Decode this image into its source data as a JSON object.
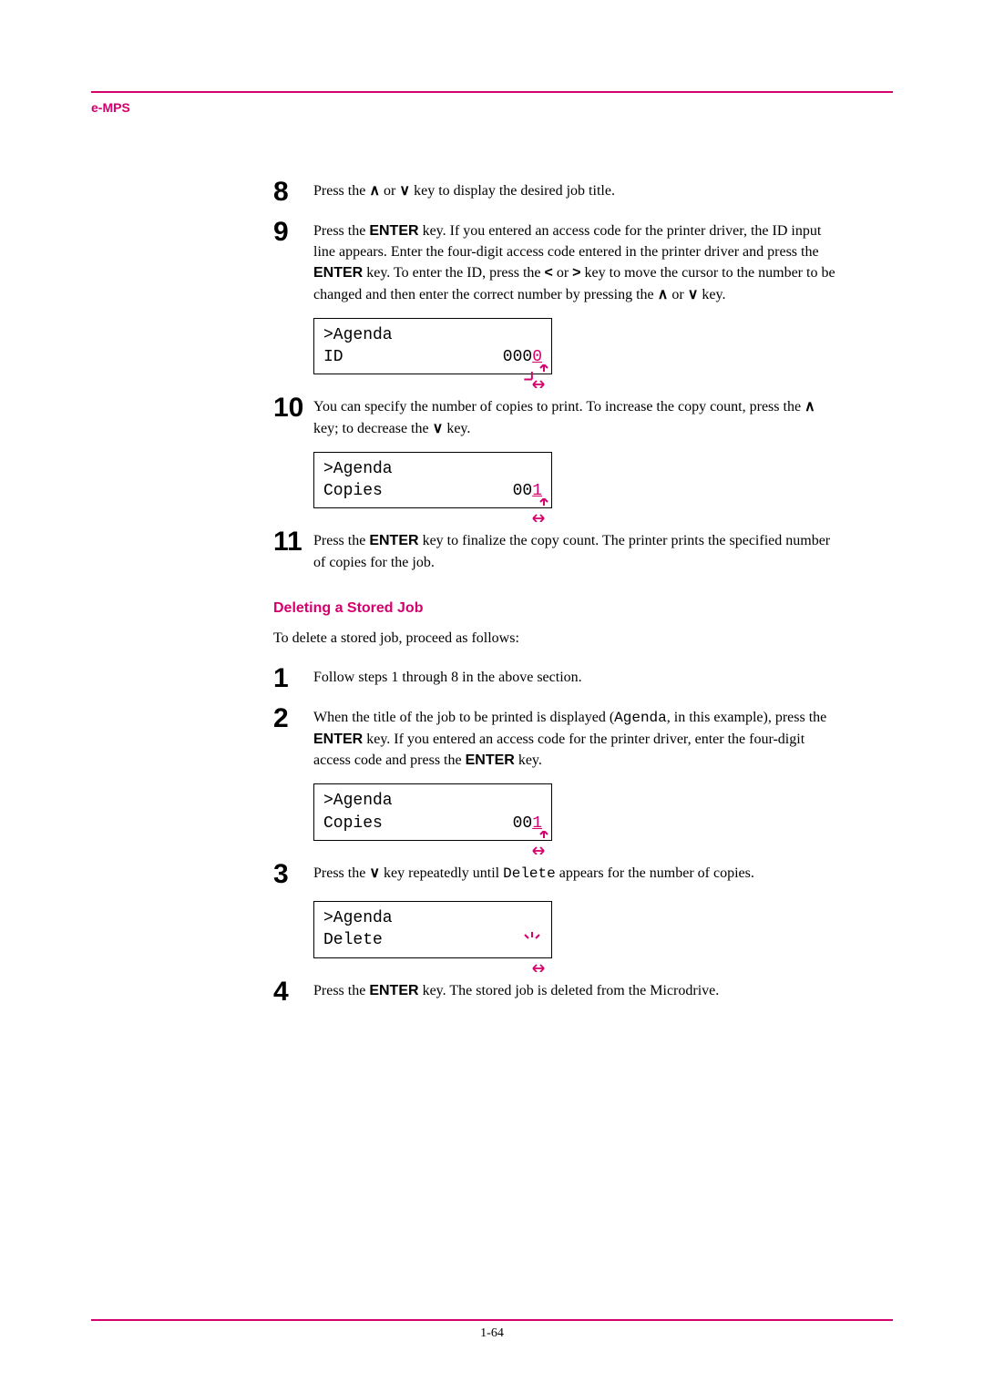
{
  "header": {
    "label": "e-MPS"
  },
  "footer": {
    "page": "1-64"
  },
  "section_title": "Deleting a Stored Job",
  "section_intro": "To delete a stored job, proceed as follows:",
  "sym": {
    "up": "∧",
    "down": "∨",
    "lt": "<",
    "gt": ">"
  },
  "steps_a": {
    "s8": {
      "num": "8",
      "text_a": "Press the ",
      "text_b": " or ",
      "text_c": " key to display the desired job title."
    },
    "s9": {
      "num": "9",
      "t1": "Press the ",
      "enter": "ENTER",
      "t2": " key. If you entered an access code for the printer driver, the ID input line appears. Enter the four-digit access code entered in the printer driver and press the ",
      "t3": " key. To enter the ID, press the ",
      "t4": " or ",
      "t5": " key to move the cursor to the number to be changed and then enter the correct number by pressing the ",
      "t6": " or ",
      "t7": " key."
    },
    "s10": {
      "num": "10",
      "t1": "You can specify the number of copies to print. To increase the copy count, press the ",
      "t2": " key; to decrease the ",
      "t3": " key."
    },
    "s11": {
      "num": "11",
      "t1": "Press the ",
      "enter": "ENTER",
      "t2": " key to finalize the copy count. The printer prints the specified number of copies for the job."
    }
  },
  "steps_b": {
    "s1": {
      "num": "1",
      "text": "Follow steps 1 through 8 in the above section."
    },
    "s2": {
      "num": "2",
      "t1": "When the title of the job to be printed is displayed (",
      "agenda": "Agenda",
      "t2": ", in this example), press the ",
      "enter": "ENTER",
      "t3": " key. If you entered an access code for the printer driver, enter the four-digit access code and press the ",
      "t4": " key."
    },
    "s3": {
      "num": "3",
      "t1": "Press the ",
      "t2": " key repeatedly until ",
      "del": "Delete",
      "t3": " appears for the number of copies."
    },
    "s4": {
      "num": "4",
      "t1": "Press the ",
      "enter": "ENTER",
      "t2": " key. The stored job is deleted from the Microdrive."
    }
  },
  "lcd1": {
    "l1": ">Agenda",
    "l2a": " ID",
    "l2b_pre": "000",
    "l2b_blink": "0"
  },
  "lcd2": {
    "l1": ">Agenda",
    "l2a": " Copies",
    "l2b_pre": "00",
    "l2b_blink": "1"
  },
  "lcd3": {
    "l1": ">Agenda",
    "l2a": " Copies",
    "l2b_pre": "00",
    "l2b_blink": "1"
  },
  "lcd4": {
    "l1": ">Agenda",
    "l2a": " Delete"
  }
}
